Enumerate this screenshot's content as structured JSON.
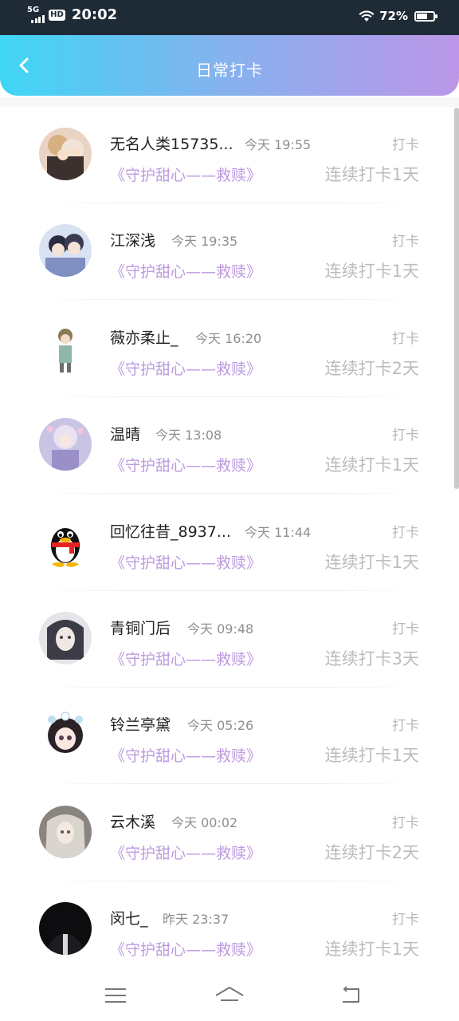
{
  "status_bar": {
    "network": "5G",
    "hd": "HD",
    "time": "20:02",
    "battery": "72%",
    "battery_level": 0.72
  },
  "header": {
    "title": "日常打卡"
  },
  "entries": [
    {
      "name": "无名人类15735...",
      "time": "今天 19:55",
      "link": "《守护甜心——救赎》",
      "tag": "打卡",
      "streak": "连续打卡1天",
      "avatar": "avatar-anime-1"
    },
    {
      "name": "江深浅",
      "time": "今天 19:35",
      "link": "《守护甜心——救赎》",
      "tag": "打卡",
      "streak": "连续打卡1天",
      "avatar": "avatar-anime-2"
    },
    {
      "name": "薇亦柔止_",
      "time": "今天 16:20",
      "link": "《守护甜心——救赎》",
      "tag": "打卡",
      "streak": "连续打卡2天",
      "avatar": "avatar-anime-3"
    },
    {
      "name": "温晴",
      "time": "今天 13:08",
      "link": "《守护甜心——救赎》",
      "tag": "打卡",
      "streak": "连续打卡1天",
      "avatar": "avatar-anime-4"
    },
    {
      "name": "回忆往昔_8937...",
      "time": "今天 11:44",
      "link": "《守护甜心——救赎》",
      "tag": "打卡",
      "streak": "连续打卡1天",
      "avatar": "avatar-penguin"
    },
    {
      "name": "青铜门后",
      "time": "今天 09:48",
      "link": "《守护甜心——救赎》",
      "tag": "打卡",
      "streak": "连续打卡3天",
      "avatar": "avatar-anime-5"
    },
    {
      "name": "铃兰亭黛",
      "time": "今天 05:26",
      "link": "《守护甜心——救赎》",
      "tag": "打卡",
      "streak": "连续打卡1天",
      "avatar": "avatar-anime-6"
    },
    {
      "name": "云木溪",
      "time": "今天 00:02",
      "link": "《守护甜心——救赎》",
      "tag": "打卡",
      "streak": "连续打卡2天",
      "avatar": "avatar-anime-7"
    },
    {
      "name": "闵七_",
      "time": "昨天 23:37",
      "link": "《守护甜心——救赎》",
      "tag": "打卡",
      "streak": "连续打卡1天",
      "avatar": "avatar-dark"
    }
  ],
  "nav_bar": {
    "menu_icon": "menu-icon",
    "home_icon": "home-icon",
    "back_icon": "back-arrow-icon"
  },
  "colors": {
    "link": "#bd9ae0",
    "header_start": "#3fd6f5",
    "header_end": "#bc96e8"
  }
}
